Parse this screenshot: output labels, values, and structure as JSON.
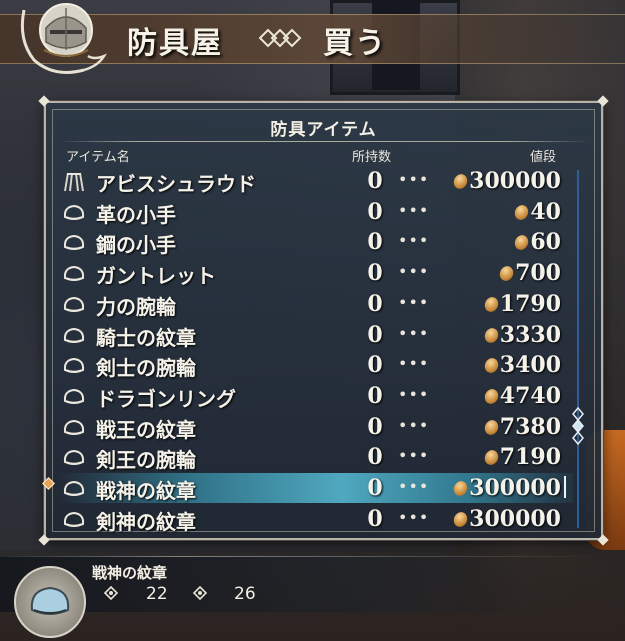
{
  "header": {
    "shop_name": "防具屋",
    "mode": "買う"
  },
  "panel": {
    "title": "防具アイテム",
    "columns": {
      "name": "アイテム名",
      "owned": "所持数",
      "price": "値段"
    }
  },
  "items": [
    {
      "icon": "cloak-icon",
      "name": "アビスシュラウド",
      "owned": "0",
      "dots": "•••",
      "price": "300000"
    },
    {
      "icon": "gauntlet-icon",
      "name": "革の小手",
      "owned": "0",
      "dots": "•••",
      "price": "40"
    },
    {
      "icon": "gauntlet-icon",
      "name": "鋼の小手",
      "owned": "0",
      "dots": "•••",
      "price": "60"
    },
    {
      "icon": "gauntlet-icon",
      "name": "ガントレット",
      "owned": "0",
      "dots": "•••",
      "price": "700"
    },
    {
      "icon": "gauntlet-icon",
      "name": "力の腕輪",
      "owned": "0",
      "dots": "•••",
      "price": "1790"
    },
    {
      "icon": "gauntlet-icon",
      "name": "騎士の紋章",
      "owned": "0",
      "dots": "•••",
      "price": "3330"
    },
    {
      "icon": "gauntlet-icon",
      "name": "剣士の腕輪",
      "owned": "0",
      "dots": "•••",
      "price": "3400"
    },
    {
      "icon": "gauntlet-icon",
      "name": "ドラゴンリング",
      "owned": "0",
      "dots": "•••",
      "price": "4740"
    },
    {
      "icon": "gauntlet-icon",
      "name": "戦王の紋章",
      "owned": "0",
      "dots": "•••",
      "price": "7380"
    },
    {
      "icon": "gauntlet-icon",
      "name": "剣王の腕輪",
      "owned": "0",
      "dots": "•••",
      "price": "7190"
    },
    {
      "icon": "gauntlet-icon",
      "name": "戦神の紋章",
      "owned": "0",
      "dots": "•••",
      "price": "300000"
    },
    {
      "icon": "gauntlet-icon",
      "name": "剣神の紋章",
      "owned": "0",
      "dots": "•••",
      "price": "300000"
    }
  ],
  "selected_index": 10,
  "footer": {
    "item_name": "戦神の紋章",
    "stat1": "22",
    "stat2": "26"
  },
  "colors": {
    "selection": "#5ab4d2",
    "cursor": "#e4a45a",
    "coin": "#c98a3a"
  }
}
